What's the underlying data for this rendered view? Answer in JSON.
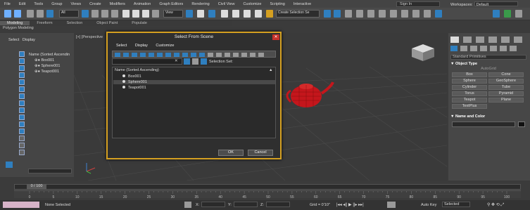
{
  "menu": [
    "File",
    "Edit",
    "Tools",
    "Group",
    "Views",
    "Create",
    "Modifiers",
    "Animation",
    "Graph Editors",
    "Rendering",
    "Civil View",
    "Customize",
    "Scripting",
    "Interactive"
  ],
  "sign_in": "Sign In",
  "workspaces": {
    "label": "Workspaces:",
    "value": "Default"
  },
  "toolbar": {
    "filter": "All",
    "view": "View",
    "selection_set": "Create Selection Se"
  },
  "ribbon": {
    "tabs": [
      "Modeling",
      "Freeform",
      "Selection",
      "Object Paint",
      "Populate"
    ],
    "sub": "Polygon Modeling"
  },
  "scene_explorer": {
    "select": "Select",
    "display": "Display",
    "header": "Name (Sorted Ascendin",
    "items": [
      "Box001",
      "Sphere001",
      "Teapot001"
    ]
  },
  "viewport_label": "[+] [Perspective",
  "dialog": {
    "title": "Select From Scene",
    "menu": [
      "Select",
      "Display",
      "Customize"
    ],
    "selection_sets": "Selection Set:",
    "column": "Name (Sorted Ascending)",
    "items": [
      "Box001",
      "Sphere001",
      "Teapot001"
    ],
    "ok": "OK",
    "cancel": "Cancel"
  },
  "command_panel": {
    "category": "Standard Primitives",
    "object_type": "Object Type",
    "autogrid": "AutoGrid",
    "buttons": [
      "Box",
      "Cone",
      "Sphere",
      "GeoSphere",
      "Cylinder",
      "Tube",
      "Torus",
      "Pyramid",
      "Teapot",
      "Plane",
      "TextPlus"
    ],
    "name_color": "Name and Color"
  },
  "timeline": {
    "frame": "0 / 100",
    "ticks": [
      "0",
      "5",
      "10",
      "15",
      "20",
      "25",
      "30",
      "35",
      "40",
      "45",
      "50",
      "55",
      "60",
      "65",
      "70",
      "75",
      "80",
      "85",
      "90",
      "95",
      "100"
    ]
  },
  "status": {
    "selection": "None Selected",
    "x": "X:",
    "y": "Y:",
    "z": "Z:",
    "grid": "Grid = 0'10\"",
    "auto_key": "Auto Key",
    "key_mode": "Selected"
  },
  "colors": {
    "accent": "#d5a021",
    "teapot": "#c4161c",
    "blue": "#2f7fbf"
  }
}
